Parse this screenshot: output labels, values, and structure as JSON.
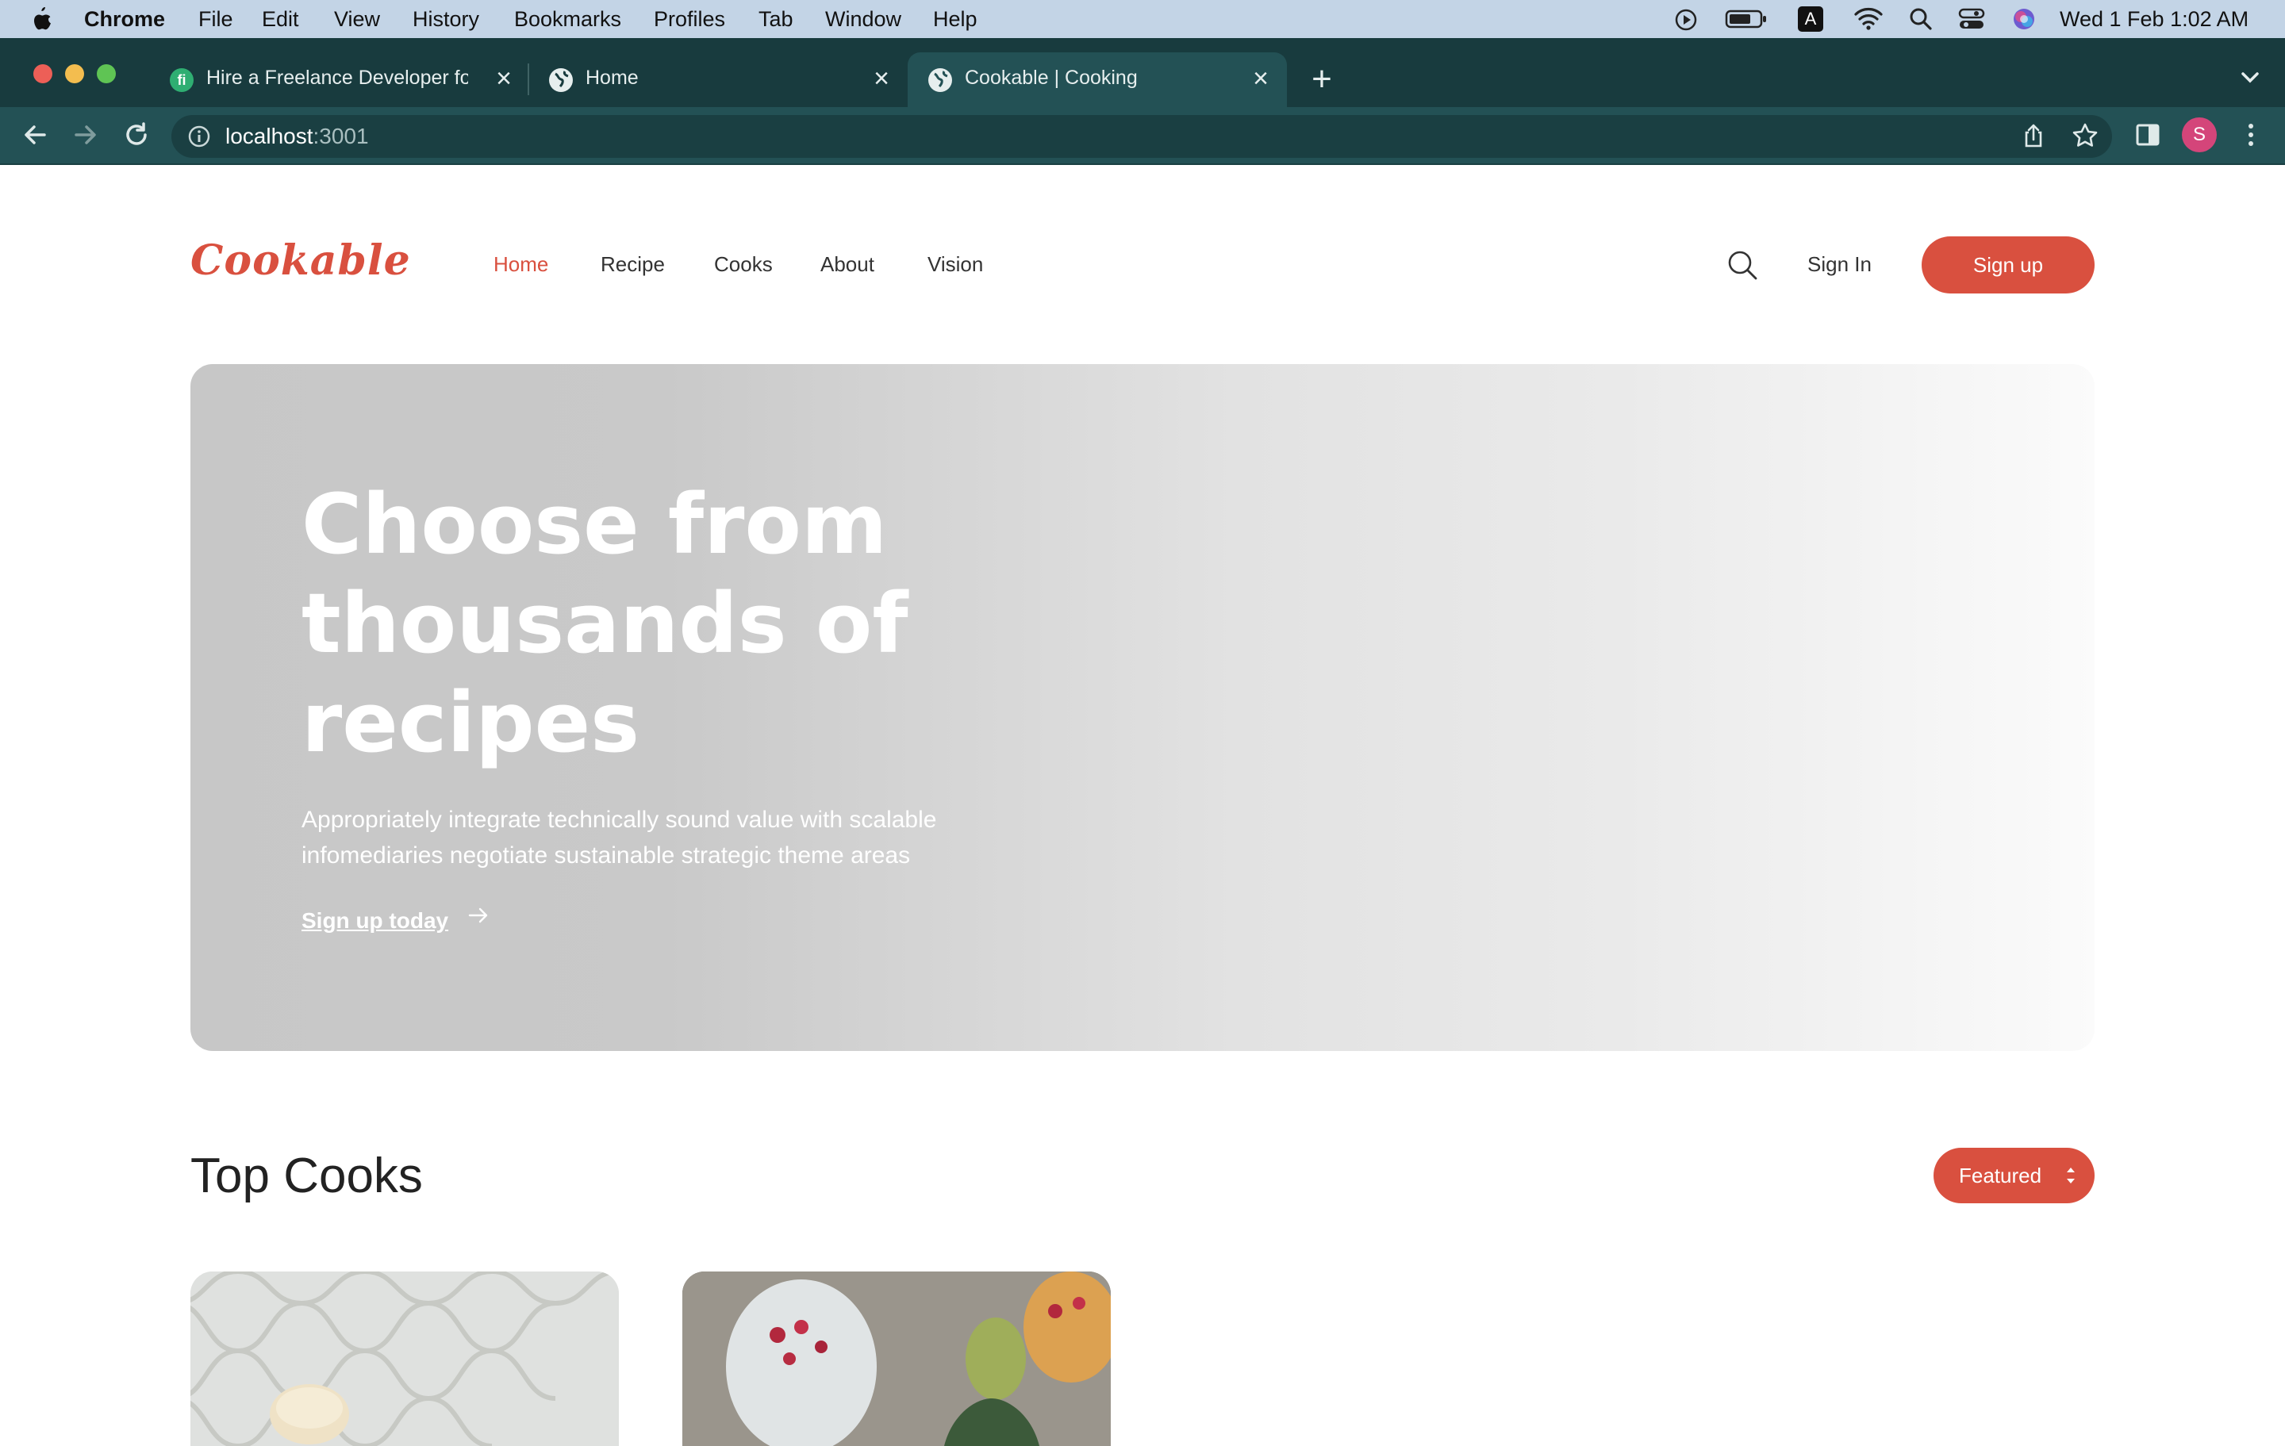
{
  "menubar": {
    "app": "Chrome",
    "items": [
      "File",
      "Edit",
      "View",
      "History",
      "Bookmarks",
      "Profiles",
      "Tab",
      "Window",
      "Help"
    ],
    "clock": "Wed 1 Feb  1:02 AM",
    "input_source": "A"
  },
  "tabs": [
    {
      "title": "Hire a Freelance Developer for",
      "favicon": "fiverr-icon",
      "active": false
    },
    {
      "title": "Home",
      "favicon": "globe-icon",
      "active": false
    },
    {
      "title": "Cookable | Cooking",
      "favicon": "globe-icon",
      "active": true
    }
  ],
  "address": {
    "host": "localhost",
    "port": ":3001"
  },
  "profile": {
    "initial": "S",
    "color": "#d4457a"
  },
  "site": {
    "logo": "Cookable",
    "nav": [
      "Home",
      "Recipe",
      "Cooks",
      "About",
      "Vision"
    ],
    "active_nav": "Home",
    "sign_in": "Sign In",
    "sign_up": "Sign up"
  },
  "hero": {
    "title_lines": [
      "Choose from",
      "thousands of",
      "recipes"
    ],
    "subtitle_lines": [
      "Appropriately integrate technically sound value with scalable",
      "infomediaries negotiate sustainable strategic theme areas"
    ],
    "cta": "Sign up today"
  },
  "top_cooks": {
    "title": "Top Cooks",
    "sort_label": "Featured"
  },
  "colors": {
    "accent": "#d9503f",
    "chrome_dark": "#183b3e",
    "chrome_toolbar": "#235155"
  }
}
